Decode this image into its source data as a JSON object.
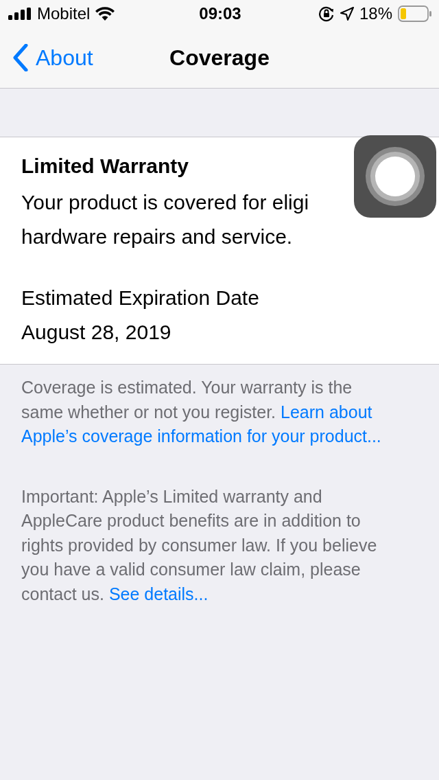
{
  "status_bar": {
    "carrier": "Mobitel",
    "time": "09:03",
    "battery": "18%"
  },
  "nav": {
    "back": "About",
    "title": "Coverage"
  },
  "warranty": {
    "title": "Limited Warranty",
    "description_lines": [
      "Your product is covered for eligi",
      "hardware repairs and service."
    ],
    "expiration_label": "Estimated Expiration Date",
    "expiration_date": "August 28, 2019"
  },
  "notes": [
    {
      "lines": [
        [
          {
            "kind": "text",
            "text": "Coverage is estimated. Your warranty is the"
          }
        ],
        [
          {
            "kind": "text",
            "text": "same whether or not you register."
          },
          {
            "kind": "link",
            "text": "Learn about"
          }
        ],
        [
          {
            "kind": "link",
            "text": "Apple’s coverage information for your product..."
          }
        ]
      ]
    },
    {
      "lines": [
        [
          {
            "kind": "text",
            "text": "Important: Apple’s Limited warranty and"
          }
        ],
        [
          {
            "kind": "text",
            "text": "AppleCare product benefits are in addition to"
          }
        ],
        [
          {
            "kind": "text",
            "text": "rights provided by consumer law. If you believe"
          }
        ],
        [
          {
            "kind": "text",
            "text": "you have a valid consumer law claim, please"
          }
        ],
        [
          {
            "kind": "text",
            "text": "contact us."
          },
          {
            "kind": "link",
            "text": "See details..."
          }
        ]
      ]
    }
  ]
}
